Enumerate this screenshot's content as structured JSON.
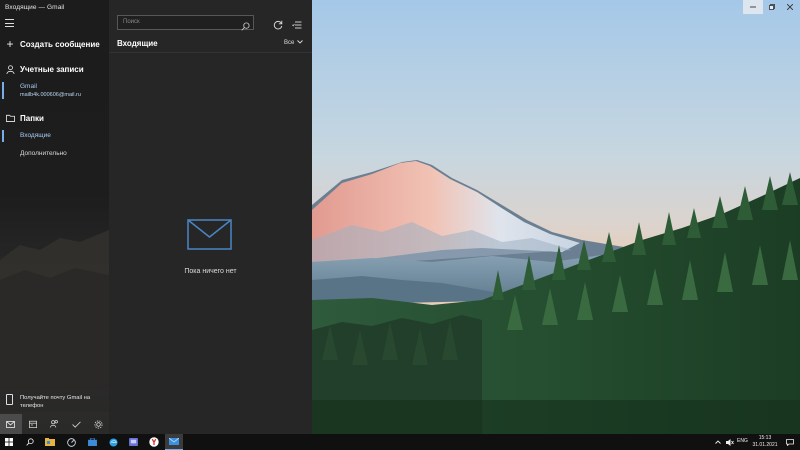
{
  "window": {
    "title": "Входящие — Gmail"
  },
  "nav": {
    "compose_label": "Создать сообщение",
    "accounts_label": "Учетные записи",
    "account": {
      "name": "Gmail",
      "email": "mailb4k.000606@mail.ru"
    },
    "folders_label": "Папки",
    "folders": [
      {
        "label": "Входящие",
        "selected": true
      },
      {
        "label": "Дополнительно",
        "selected": false
      }
    ],
    "promo_text": "Получайте почту Gmail на телефон",
    "bottom_buttons": [
      "mail-icon",
      "calendar-icon",
      "people-icon",
      "todo-icon",
      "settings-icon"
    ]
  },
  "list": {
    "search_placeholder": "Поиск",
    "title": "Входящие",
    "filter_label": "Все",
    "empty_text": "Пока ничего нет"
  },
  "taskbar": {
    "apps": [
      "start-icon",
      "search-icon",
      "file-explorer-icon",
      "speedometer-icon",
      "store-icon",
      "edge-icon",
      "app-icon",
      "yandex-browser-icon",
      "mail-app-icon"
    ],
    "active_app": "mail-app-icon",
    "language": "ENG",
    "time": "15:13",
    "date": "31.01.2021"
  },
  "colors": {
    "accent": "#77aee8",
    "nav_bg": "#1c1c1c",
    "list_bg": "#262626"
  }
}
